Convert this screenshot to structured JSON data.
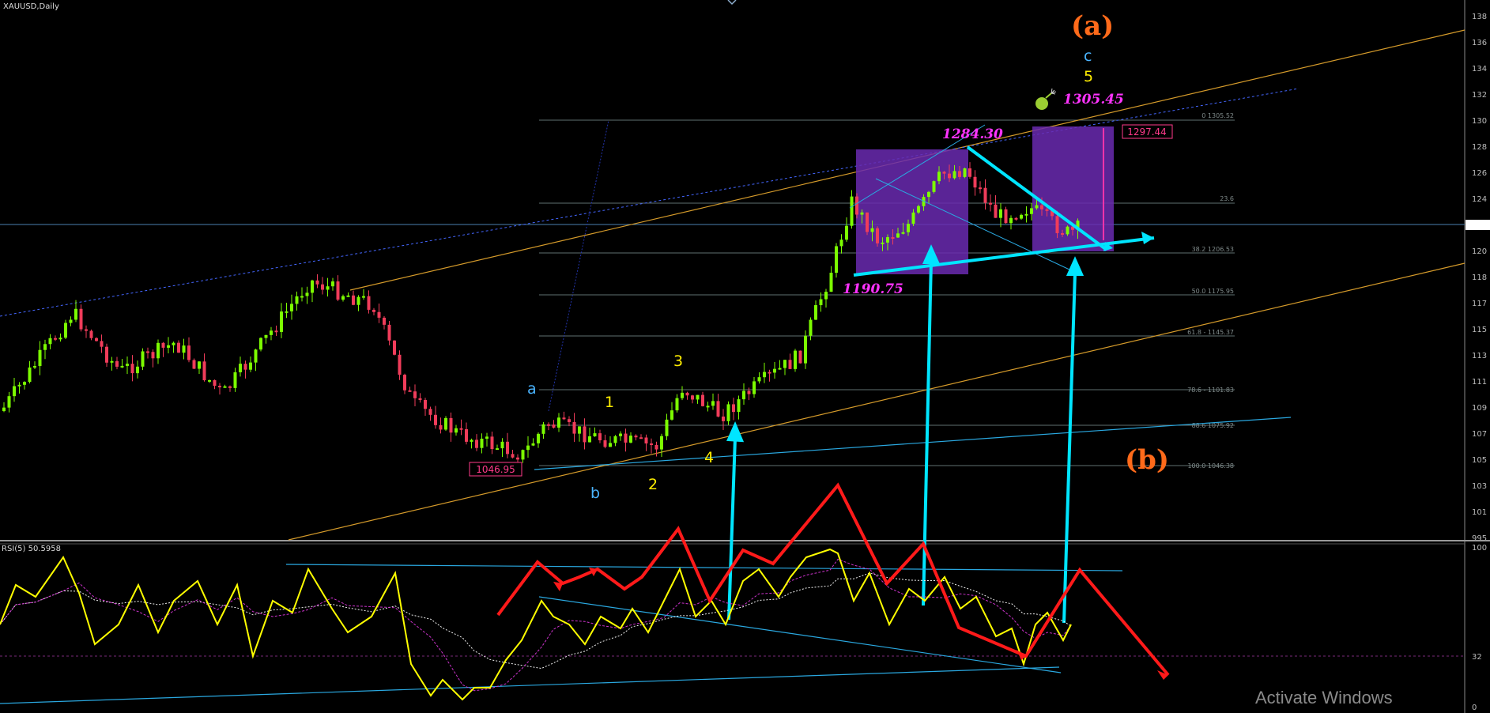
{
  "header": {
    "symbol_label": "XAUUSD,Daily",
    "rsi_label": "RSI(5) 50.5958"
  },
  "price_axis": [
    "138",
    "136",
    "134",
    "132",
    "130",
    "128",
    "126",
    "124",
    "122",
    "120",
    "118",
    "117",
    "115",
    "113",
    "111",
    "109",
    "107",
    "105",
    "103",
    "101",
    "995"
  ],
  "rsi_axis": [
    "100",
    "32",
    "0"
  ],
  "fib_levels": [
    {
      "label": "0 1305.52"
    },
    {
      "label": "23.6"
    },
    {
      "label": "38.2 1206.53"
    },
    {
      "label": "50.0 1175.95"
    },
    {
      "label": "61.8 - 1145.37"
    },
    {
      "label": "78.6 - 1101.83"
    },
    {
      "label": "88.6 1075.92"
    },
    {
      "label": "100.0 1046.38"
    }
  ],
  "price_boxes": {
    "low": "1046.95",
    "target": "1297.44"
  },
  "annotations": {
    "wave_a_big": "(a)",
    "wave_b_big": "(b)",
    "wave_c": "c",
    "wave_5_top": "5",
    "wave_a_small": "a",
    "wave_b_small": "b",
    "wave_1": "1",
    "wave_2": "2",
    "wave_3": "3",
    "wave_4": "4",
    "high_value": "1284.30",
    "low_value": "1190.75",
    "target_value": "1305.45"
  },
  "watermark": "Activate Windows",
  "colors": {
    "background": "#000000",
    "bull_candle": "#7cfc00",
    "bear_candle": "#f03c5a",
    "rsi_line": "#ffff00",
    "fib_line": "#5f6f6f",
    "channel": "#d49a2a",
    "trendline": "#2aa8e0",
    "cyan_arrow": "#00e5ff",
    "red_zigzag": "#ff1a1a",
    "magenta_text": "#ff33ff",
    "purple_box": "#6a2ab0",
    "orange_label": "#ff6a1a"
  },
  "chart_data": {
    "type": "candlestick",
    "title": "XAUUSD,Daily",
    "indicator": "RSI(5)",
    "indicator_value": 50.5958,
    "indicator_levels": [
      100,
      32,
      0
    ],
    "fibonacci": [
      {
        "ratio": 0,
        "price": 1305.52
      },
      {
        "ratio": 23.6,
        "price": null
      },
      {
        "ratio": 38.2,
        "price": 1206.53
      },
      {
        "ratio": 50.0,
        "price": 1175.95
      },
      {
        "ratio": 61.8,
        "price": 1145.37
      },
      {
        "ratio": 78.6,
        "price": 1101.83
      },
      {
        "ratio": 88.6,
        "price": 1075.92
      },
      {
        "ratio": 100.0,
        "price": 1046.38
      }
    ],
    "marked_prices": [
      1046.95,
      1190.75,
      1284.3,
      1297.44,
      1305.45
    ],
    "elliott_waves": [
      "(a)",
      "(b)",
      "a",
      "b",
      "c",
      "1",
      "2",
      "3",
      "4",
      "5"
    ]
  }
}
